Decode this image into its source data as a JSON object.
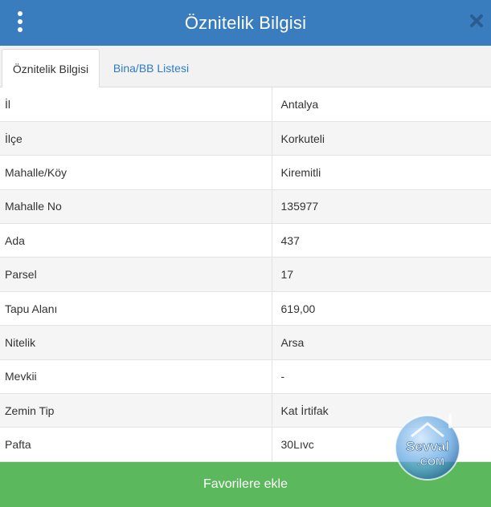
{
  "header": {
    "title": "Öznitelik Bilgisi",
    "menu_icon": "kebab-menu-icon",
    "close_icon": "close-icon",
    "bg_color": "#3a7dbf"
  },
  "tabs": [
    {
      "label": "Öznitelik Bilgisi",
      "active": true
    },
    {
      "label": "Bina/BB Listesi",
      "active": false
    }
  ],
  "attributes": [
    {
      "key": "İl",
      "value": "Antalya"
    },
    {
      "key": "İlçe",
      "value": "Korkuteli"
    },
    {
      "key": "Mahalle/Köy",
      "value": "Kiremitli"
    },
    {
      "key": "Mahalle No",
      "value": "135977"
    },
    {
      "key": "Ada",
      "value": "437"
    },
    {
      "key": "Parsel",
      "value": "17"
    },
    {
      "key": "Tapu Alanı",
      "value": "619,00"
    },
    {
      "key": "Nitelik",
      "value": "Arsa"
    },
    {
      "key": "Mevkii",
      "value": "-"
    },
    {
      "key": "Zemin Tip",
      "value": "Kat İrtifak"
    },
    {
      "key": "Pafta",
      "value": "30Lıvc"
    }
  ],
  "footer": {
    "button_label": "Favorilere ekle",
    "bg_color": "#5cb85c"
  },
  "watermark": {
    "line1": "Sevval",
    "line2": ".COM"
  }
}
